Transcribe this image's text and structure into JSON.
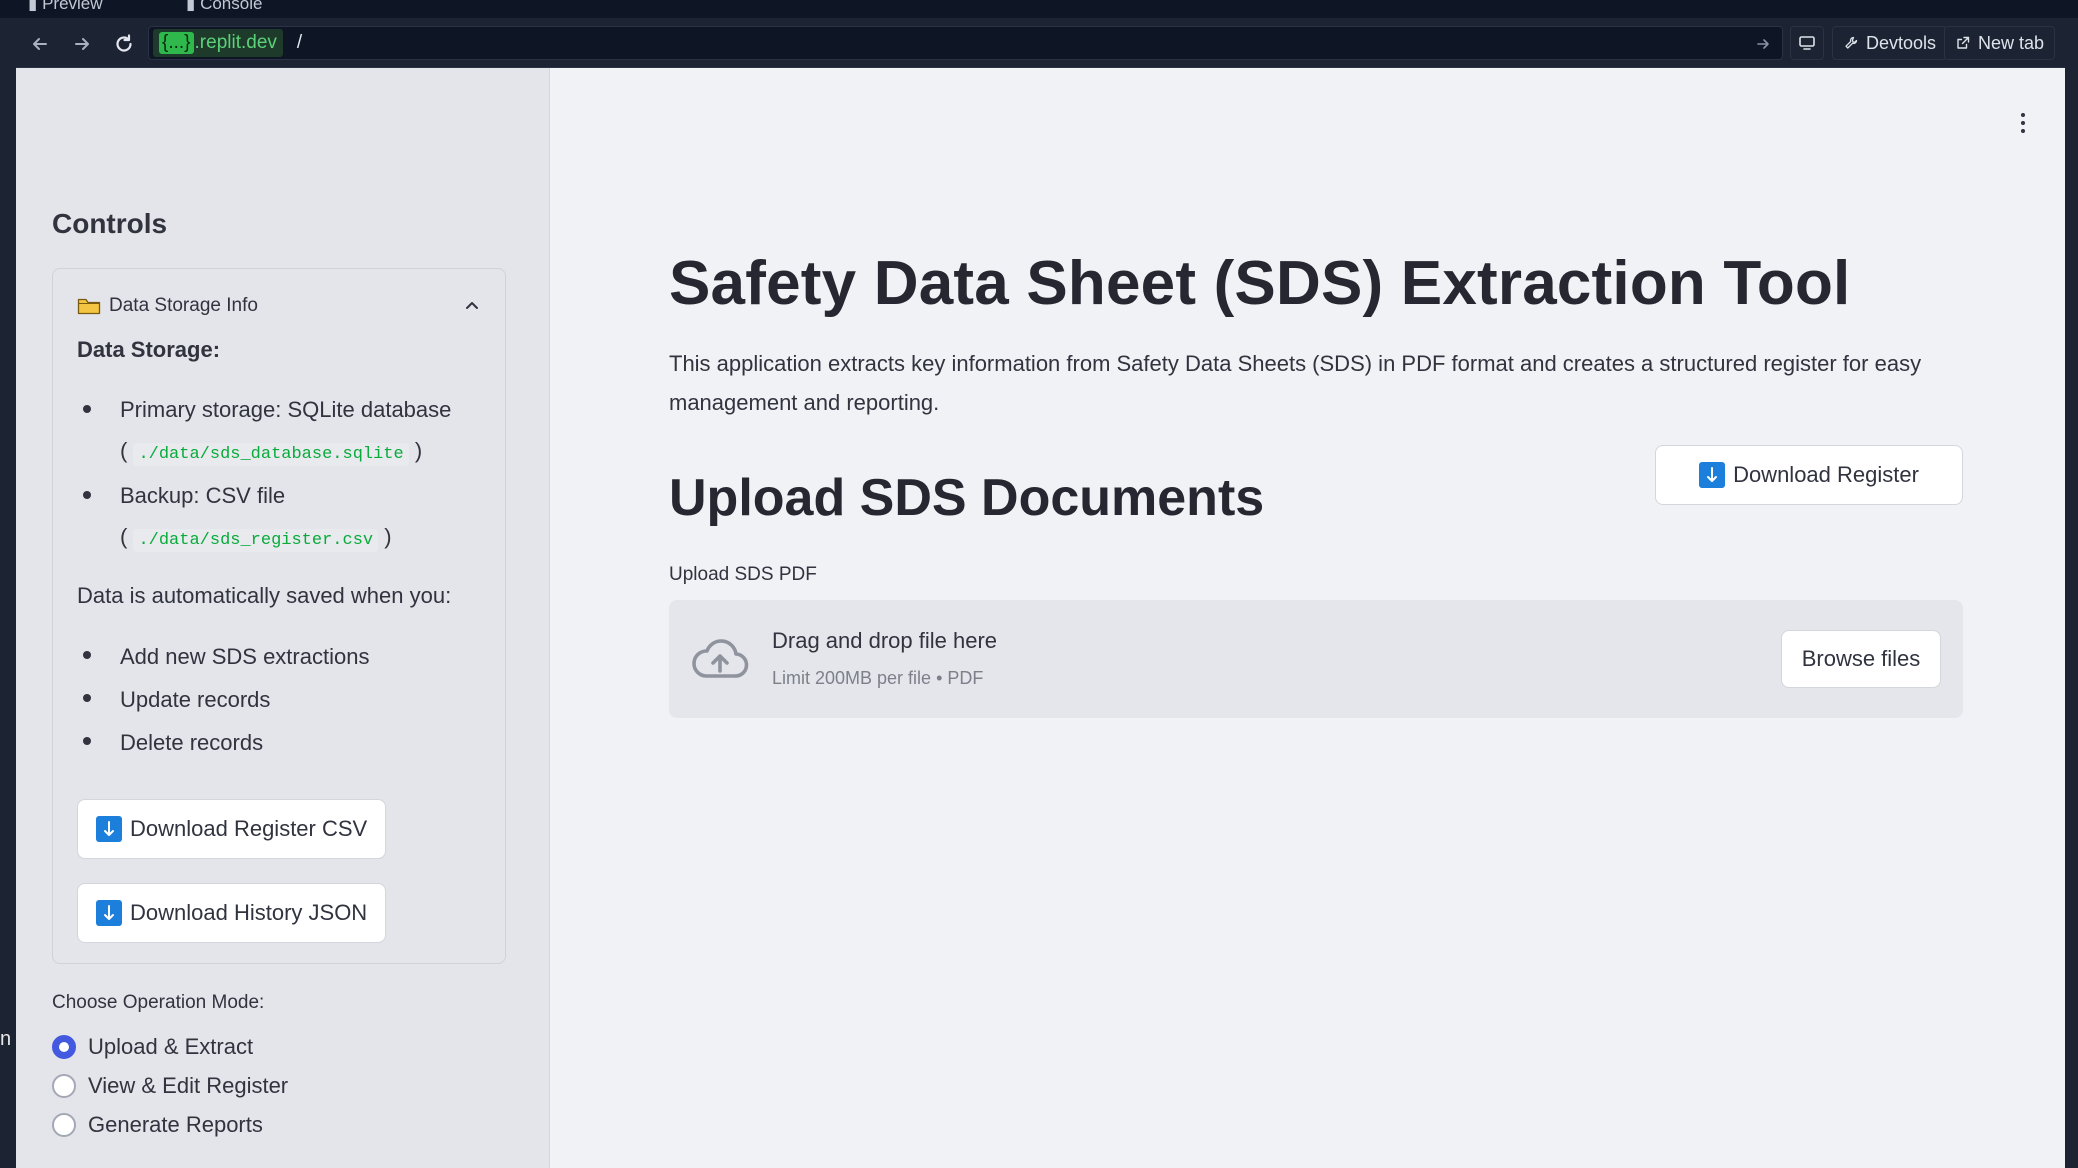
{
  "browser": {
    "tabs": [
      "Preview",
      "Console"
    ],
    "url_host_bracket": "{...}",
    "url_host": ".replit.dev",
    "url_path": "/",
    "devtools_label": "Devtools",
    "new_tab_label": "New tab",
    "edge_marker": "n"
  },
  "sidebar": {
    "title": "Controls",
    "expander": {
      "label": "Data Storage Info",
      "heading": "Data Storage:",
      "primary_text": "Primary storage: SQLite database",
      "primary_path": "./data/sds_database.sqlite",
      "backup_text": "Backup: CSV file",
      "backup_path": "./data/sds_register.csv",
      "auto_text": "Data is automatically saved when you:",
      "actions": [
        "Add new SDS extractions",
        "Update records",
        "Delete records"
      ],
      "download_csv_label": "Download Register CSV",
      "download_json_label": "Download History JSON"
    },
    "mode_label": "Choose Operation Mode:",
    "modes": [
      {
        "label": "Upload & Extract",
        "selected": true
      },
      {
        "label": "View & Edit Register",
        "selected": false
      },
      {
        "label": "Generate Reports",
        "selected": false
      }
    ]
  },
  "main": {
    "title": "Safety Data Sheet (SDS) Extraction Tool",
    "intro": "This application extracts key information from Safety Data Sheets (SDS) in PDF format and creates a structured register for easy management and reporting.",
    "download_register_label": "Download Register",
    "upload_heading": "Upload SDS Documents",
    "upload_label": "Upload SDS PDF",
    "dropzone_title": "Drag and drop file here",
    "dropzone_limit": "Limit 200MB per file • PDF",
    "browse_label": "Browse files"
  },
  "colors": {
    "accent": "#4259e0",
    "code_green": "#09ab3b",
    "download_icon_blue": "#1c7fdc"
  }
}
